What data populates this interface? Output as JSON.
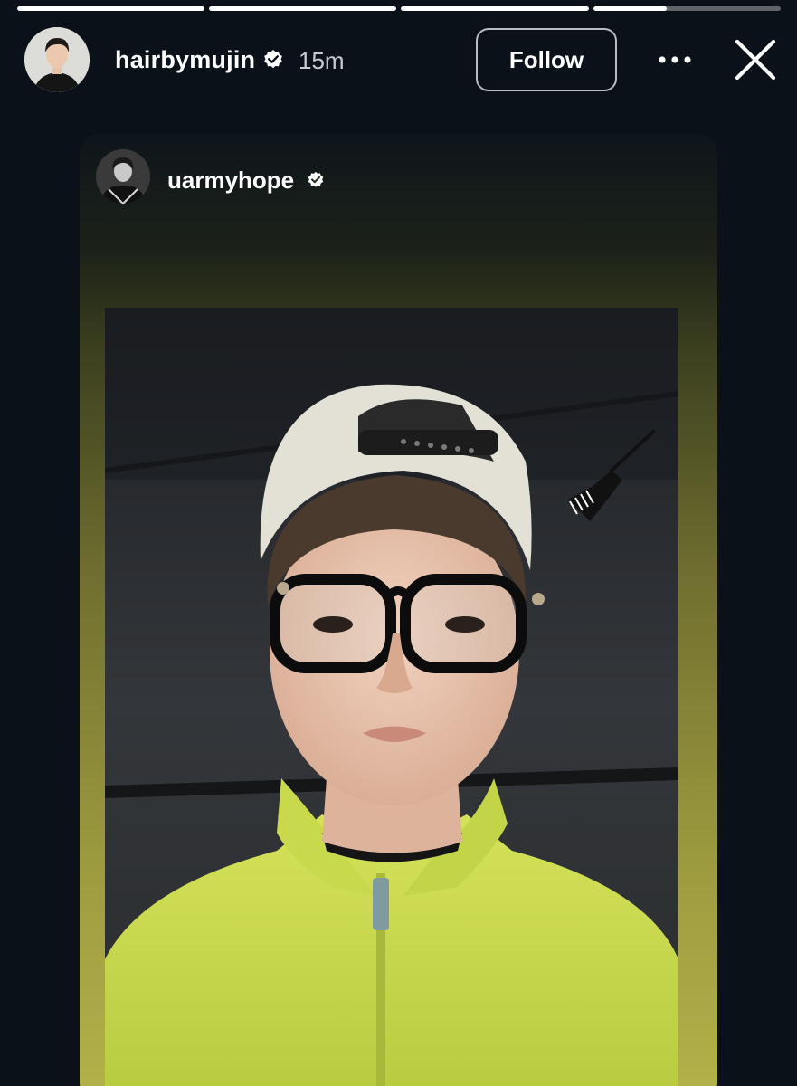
{
  "story": {
    "progress_segments": [
      {
        "fill": 1.0
      },
      {
        "fill": 1.0
      },
      {
        "fill": 1.0
      },
      {
        "fill": 0.39
      }
    ]
  },
  "header": {
    "username": "hairbymujin",
    "timestamp": "15m",
    "follow_label": "Follow",
    "avatar_icon": "profile-photo",
    "more_icon": "more-horizontal-icon",
    "close_icon": "close-icon"
  },
  "shared_post": {
    "username": "uarmyhope",
    "avatar_icon": "profile-photo",
    "sticker_icon": "hair-dye-brush-icon"
  },
  "colors": {
    "background": "#0b1119",
    "text_primary": "#ffffff",
    "text_secondary": "#c9ccd1",
    "card_gradient_bottom": "#b4b24a",
    "jacket": "#c5d84a"
  }
}
